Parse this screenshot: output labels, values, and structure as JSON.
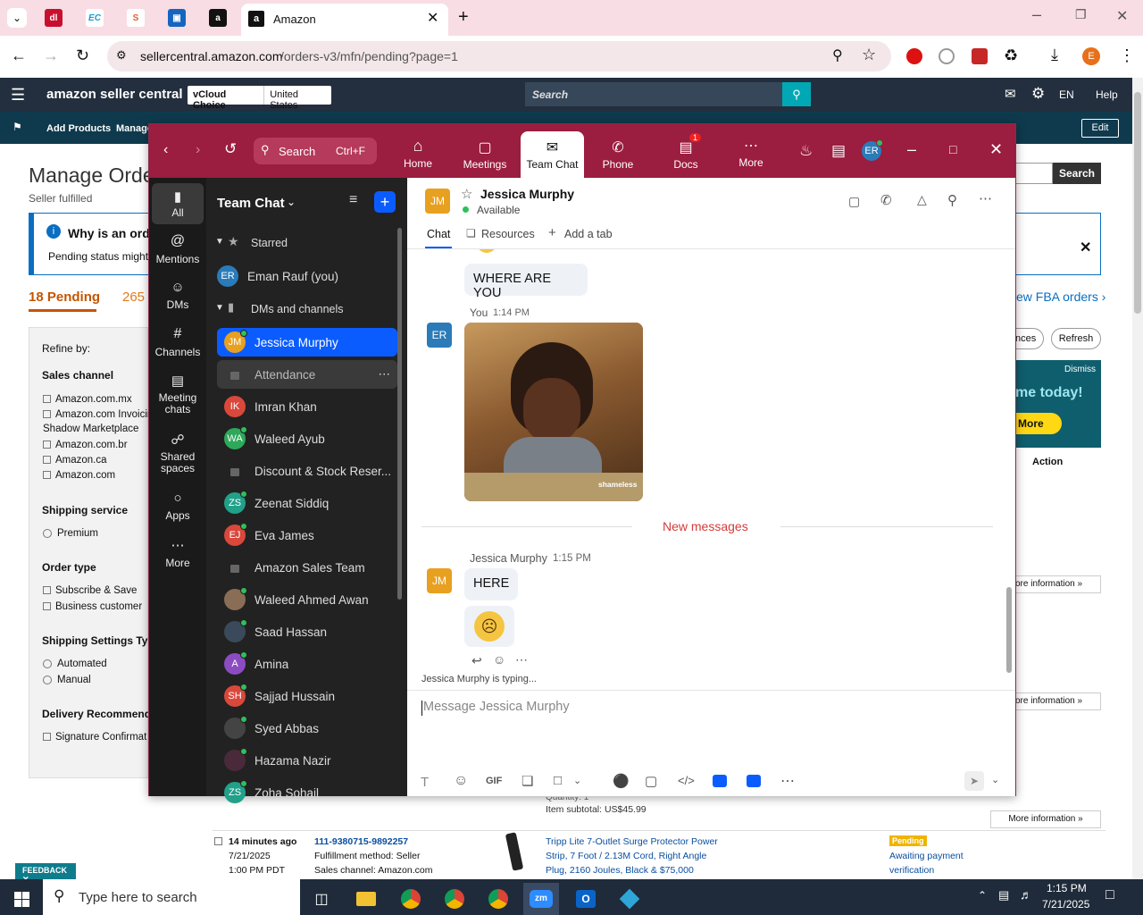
{
  "browser": {
    "active_tab_title": "Amazon",
    "url_host": "sellercentral.amazon.com",
    "url_path": "/orders-v3/mfn/pending?page=1",
    "profile_initial": "E"
  },
  "amazon": {
    "logo": "amazon seller central",
    "store_name": "vCloud Choice",
    "region": "United States",
    "search_placeholder": "Search",
    "lang": "EN",
    "help": "Help",
    "nav_add_products": "Add Products",
    "nav_manage": "Manage",
    "edit": "Edit",
    "page_title": "Manage Orde",
    "subtitle": "Seller fulfilled",
    "info_title": "Why is an ord",
    "info_text": "Pending status might",
    "tab_pending": "18 Pending",
    "tab_other": "265",
    "fba_link": "ew FBA orders ›",
    "search_btn": "Search",
    "btn_ances": "nces",
    "btn_refresh": "Refresh",
    "banner_dismiss": "Dismiss",
    "banner_text": "me today!",
    "banner_more": "More",
    "action_col": "Action",
    "more_info": "ore information",
    "more_info_full": "More information",
    "refine": "Refine by:",
    "sales_channel": "Sales channel",
    "channels": [
      "Amazon.com.mx",
      "Amazon.com Invoicin",
      "Shadow Marketplace",
      "Amazon.com.br",
      "Amazon.ca",
      "Amazon.com"
    ],
    "shipping_service": "Shipping service",
    "premium": "Premium",
    "order_type": "Order type",
    "order_types": [
      "Subscribe & Save",
      "Business customer"
    ],
    "shipping_settings": "Shipping Settings Type",
    "ship_settings_opts": [
      "Automated",
      "Manual"
    ],
    "delivery_rec": "Delivery Recommenda",
    "signature": "Signature Confirmat",
    "quantity_partial": "Quantity: 1",
    "item_subtotal": "Item subtotal: US$45.99",
    "order": {
      "age": "14 minutes ago",
      "date": "7/21/2025",
      "time": "1:00 PM PDT",
      "id": "111-9380715-9892257",
      "fulfillment": "Fulfillment method: Seller",
      "channel": "Sales channel: Amazon.com",
      "product_lines": [
        "Tripp Lite 7-Outlet Surge Protector Power",
        "Strip, 7 Foot / 2.13M Cord, Right Angle",
        "Plug, 2160 Joules, Black & $75,000"
      ],
      "status_badge": "Pending",
      "status_lines": [
        "Awaiting payment",
        "verification"
      ]
    },
    "feedback": "FEEDBACK"
  },
  "zoom": {
    "search_label": "Search",
    "search_shortcut": "Ctrl+F",
    "nav": [
      {
        "label": "Home",
        "icon": "home-icon"
      },
      {
        "label": "Meetings",
        "icon": "video-icon"
      },
      {
        "label": "Team Chat",
        "icon": "chat-icon"
      },
      {
        "label": "Phone",
        "icon": "phone-icon"
      },
      {
        "label": "Docs",
        "icon": "docs-icon",
        "badge": "1"
      },
      {
        "label": "More",
        "icon": "more-icon"
      }
    ],
    "user_initials": "ER",
    "rail": [
      "All",
      "Mentions",
      "DMs",
      "Channels",
      "Meeting chats",
      "Shared spaces",
      "Apps",
      "More"
    ],
    "list_title": "Team Chat",
    "section_starred": "Starred",
    "section_dms": "DMs and channels",
    "starred": [
      {
        "name": "Eman Rauf (you)",
        "initials": "ER",
        "color": "#2b7bb9"
      }
    ],
    "chats": [
      {
        "name": "Jessica Murphy",
        "initials": "JM",
        "color": "#e8a020",
        "online": true
      },
      {
        "name": "Attendance",
        "lock": true
      },
      {
        "name": "Imran Khan",
        "initials": "IK",
        "color": "#d9483b"
      },
      {
        "name": "Waleed Ayub",
        "initials": "WA",
        "color": "#2ea85a",
        "online": true
      },
      {
        "name": "Discount & Stock Reser...",
        "lock": true
      },
      {
        "name": "Zeenat Siddiq",
        "initials": "ZS",
        "color": "#21a08a",
        "online": true
      },
      {
        "name": "Eva James",
        "initials": "EJ",
        "color": "#d9483b",
        "online": true
      },
      {
        "name": "Amazon Sales Team",
        "lock": true
      },
      {
        "name": "Waleed Ahmed Awan",
        "initials": "",
        "color": "#8a6d55",
        "online": true
      },
      {
        "name": "Saad Hassan",
        "initials": "",
        "color": "#3a4a5a",
        "online": true
      },
      {
        "name": "Amina",
        "initials": "A",
        "color": "#8b4cc2",
        "online": true
      },
      {
        "name": "Sajjad Hussain",
        "initials": "SH",
        "color": "#d9483b",
        "online": true
      },
      {
        "name": "Syed Abbas",
        "initials": "",
        "color": "#444",
        "online": true
      },
      {
        "name": "Hazama Nazir",
        "initials": "",
        "color": "#4a2a3a",
        "online": true
      },
      {
        "name": "Zoha Sohail",
        "initials": "ZS",
        "color": "#21a08a",
        "online": true
      }
    ],
    "contact_name": "Jessica Murphy",
    "contact_initials": "JM",
    "contact_status": "Available",
    "tabs": [
      "Chat",
      "Resources",
      "Add a tab"
    ],
    "msg1": "WHERE ARE YOU",
    "you_label": "You",
    "you_time": "1:14 PM",
    "gif_watermark": "shameless",
    "new_messages": "New messages",
    "jm_label": "Jessica Murphy",
    "jm_time": "1:15 PM",
    "msg2": "HERE",
    "typing": "Jessica Murphy is typing...",
    "composer_placeholder": "Message Jessica Murphy",
    "gif_btn": "GIF"
  },
  "taskbar": {
    "search_placeholder": "Type here to search",
    "time": "1:15 PM",
    "date": "7/21/2025"
  },
  "colors": {
    "zoom_header": "#9b1d3f",
    "amazon_header": "#232f3e",
    "accent_blue": "#0b5cff"
  }
}
